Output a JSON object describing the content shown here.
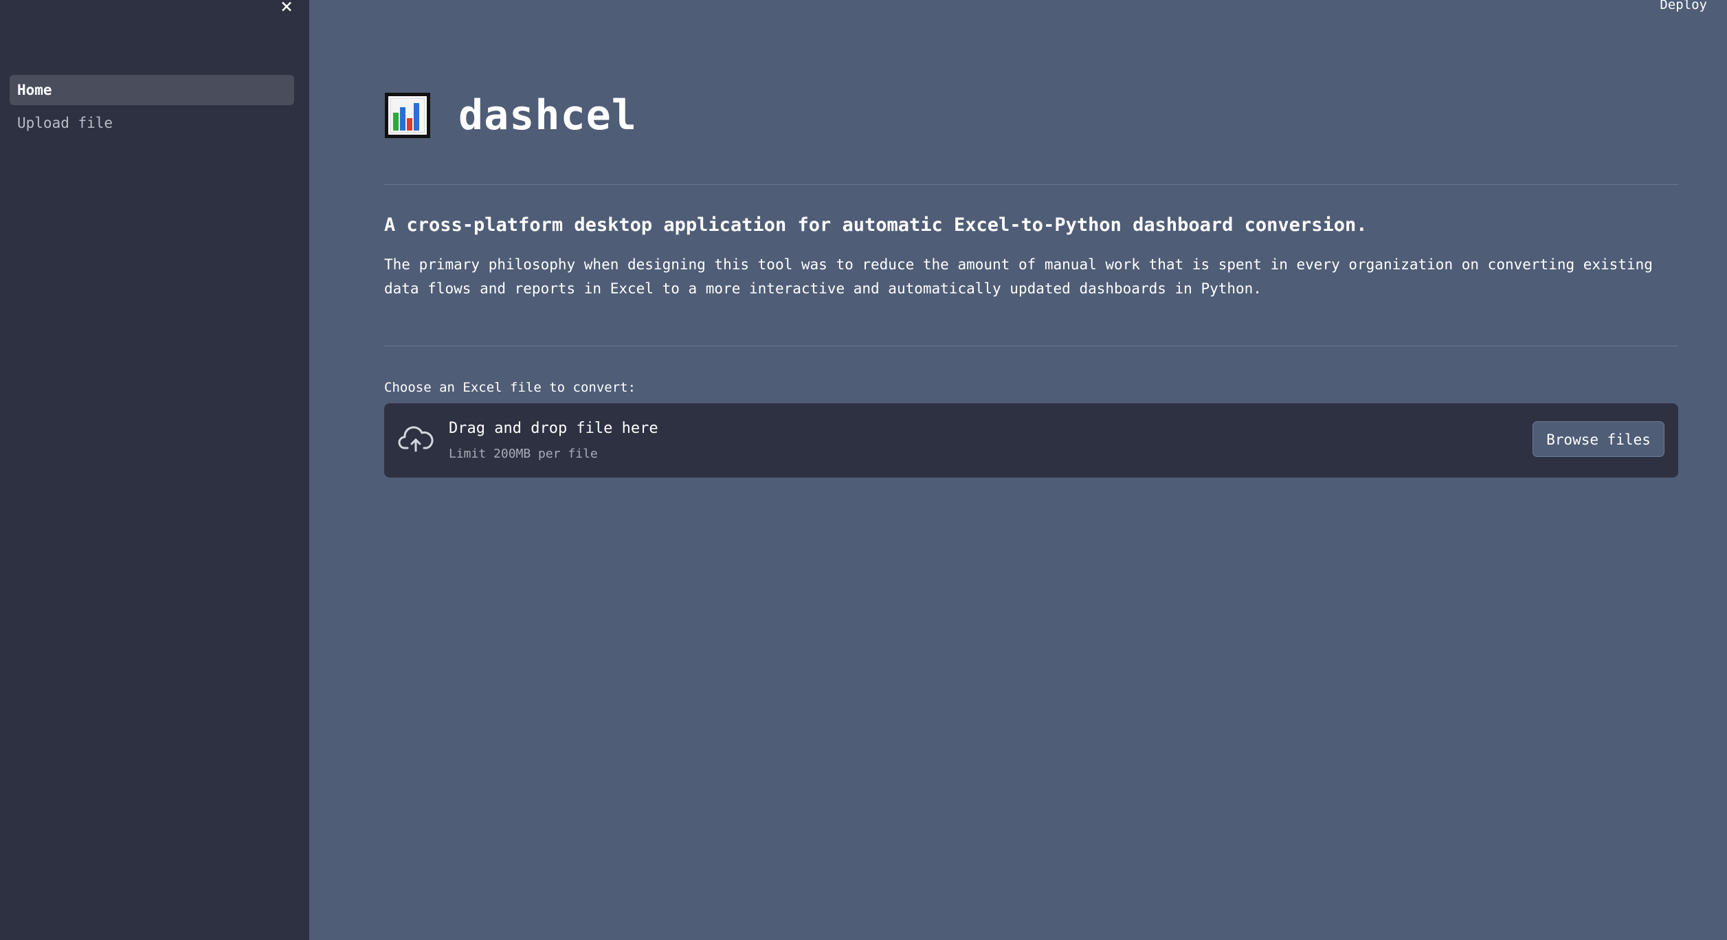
{
  "sidebar": {
    "close_icon": "×",
    "items": [
      {
        "label": "Home",
        "active": true
      },
      {
        "label": "Upload file",
        "active": false
      }
    ]
  },
  "header": {
    "deploy_label": "Deploy"
  },
  "main": {
    "logo_icon": "bar-chart-icon",
    "title": "dashcel",
    "subtitle": "A cross-platform desktop application for automatic Excel-to-Python dashboard conversion.",
    "description": "The primary philosophy when designing this tool was to reduce the amount of manual work that is spent in every organization on converting existing data flows and reports in Excel to a more interactive and automatically updated dashboards in Python.",
    "uploader": {
      "label": "Choose an Excel file to convert:",
      "drop_title": "Drag and drop file here",
      "drop_limit": "Limit 200MB per file",
      "browse_label": "Browse files",
      "icon": "cloud-upload-icon"
    }
  },
  "colors": {
    "background": "#4f5d76",
    "sidebar": "#2e3142",
    "text": "#ffffff"
  }
}
